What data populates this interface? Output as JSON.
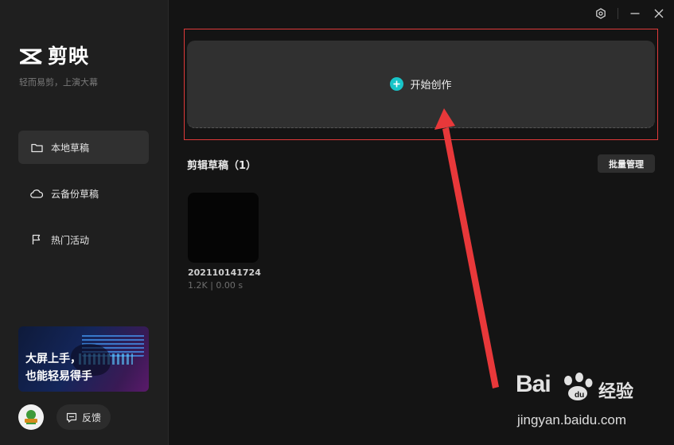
{
  "app": {
    "name": "剪映",
    "slogan": "轻而易剪，上演大幕"
  },
  "sidebar": {
    "items": [
      {
        "label": "本地草稿",
        "icon": "folder-icon",
        "active": true
      },
      {
        "label": "云备份草稿",
        "icon": "cloud-icon",
        "active": false
      },
      {
        "label": "热门活动",
        "icon": "flag-icon",
        "active": false
      }
    ],
    "banner": {
      "line1": "大屏上手，",
      "line2": "也能轻易得手"
    },
    "avatar_icon": "avatar-icon",
    "feedback_label": "反馈"
  },
  "window_controls": [
    "settings-icon",
    "minimize-icon",
    "close-icon"
  ],
  "main": {
    "create_label": "开始创作",
    "drafts_title": "剪辑草稿（1）",
    "batch_manage_label": "批量管理",
    "drafts": [
      {
        "name": "202110141724",
        "meta": "1.2K | 0.00 s"
      }
    ]
  },
  "watermark": {
    "brand_latin": "Bai",
    "brand_cn": "经验",
    "url": "jingyan.baidu.com"
  },
  "colors": {
    "accent": "#18c4c8",
    "annotation": "#e03a3a",
    "background": "#141414",
    "sidebar": "#1f1f1f"
  }
}
